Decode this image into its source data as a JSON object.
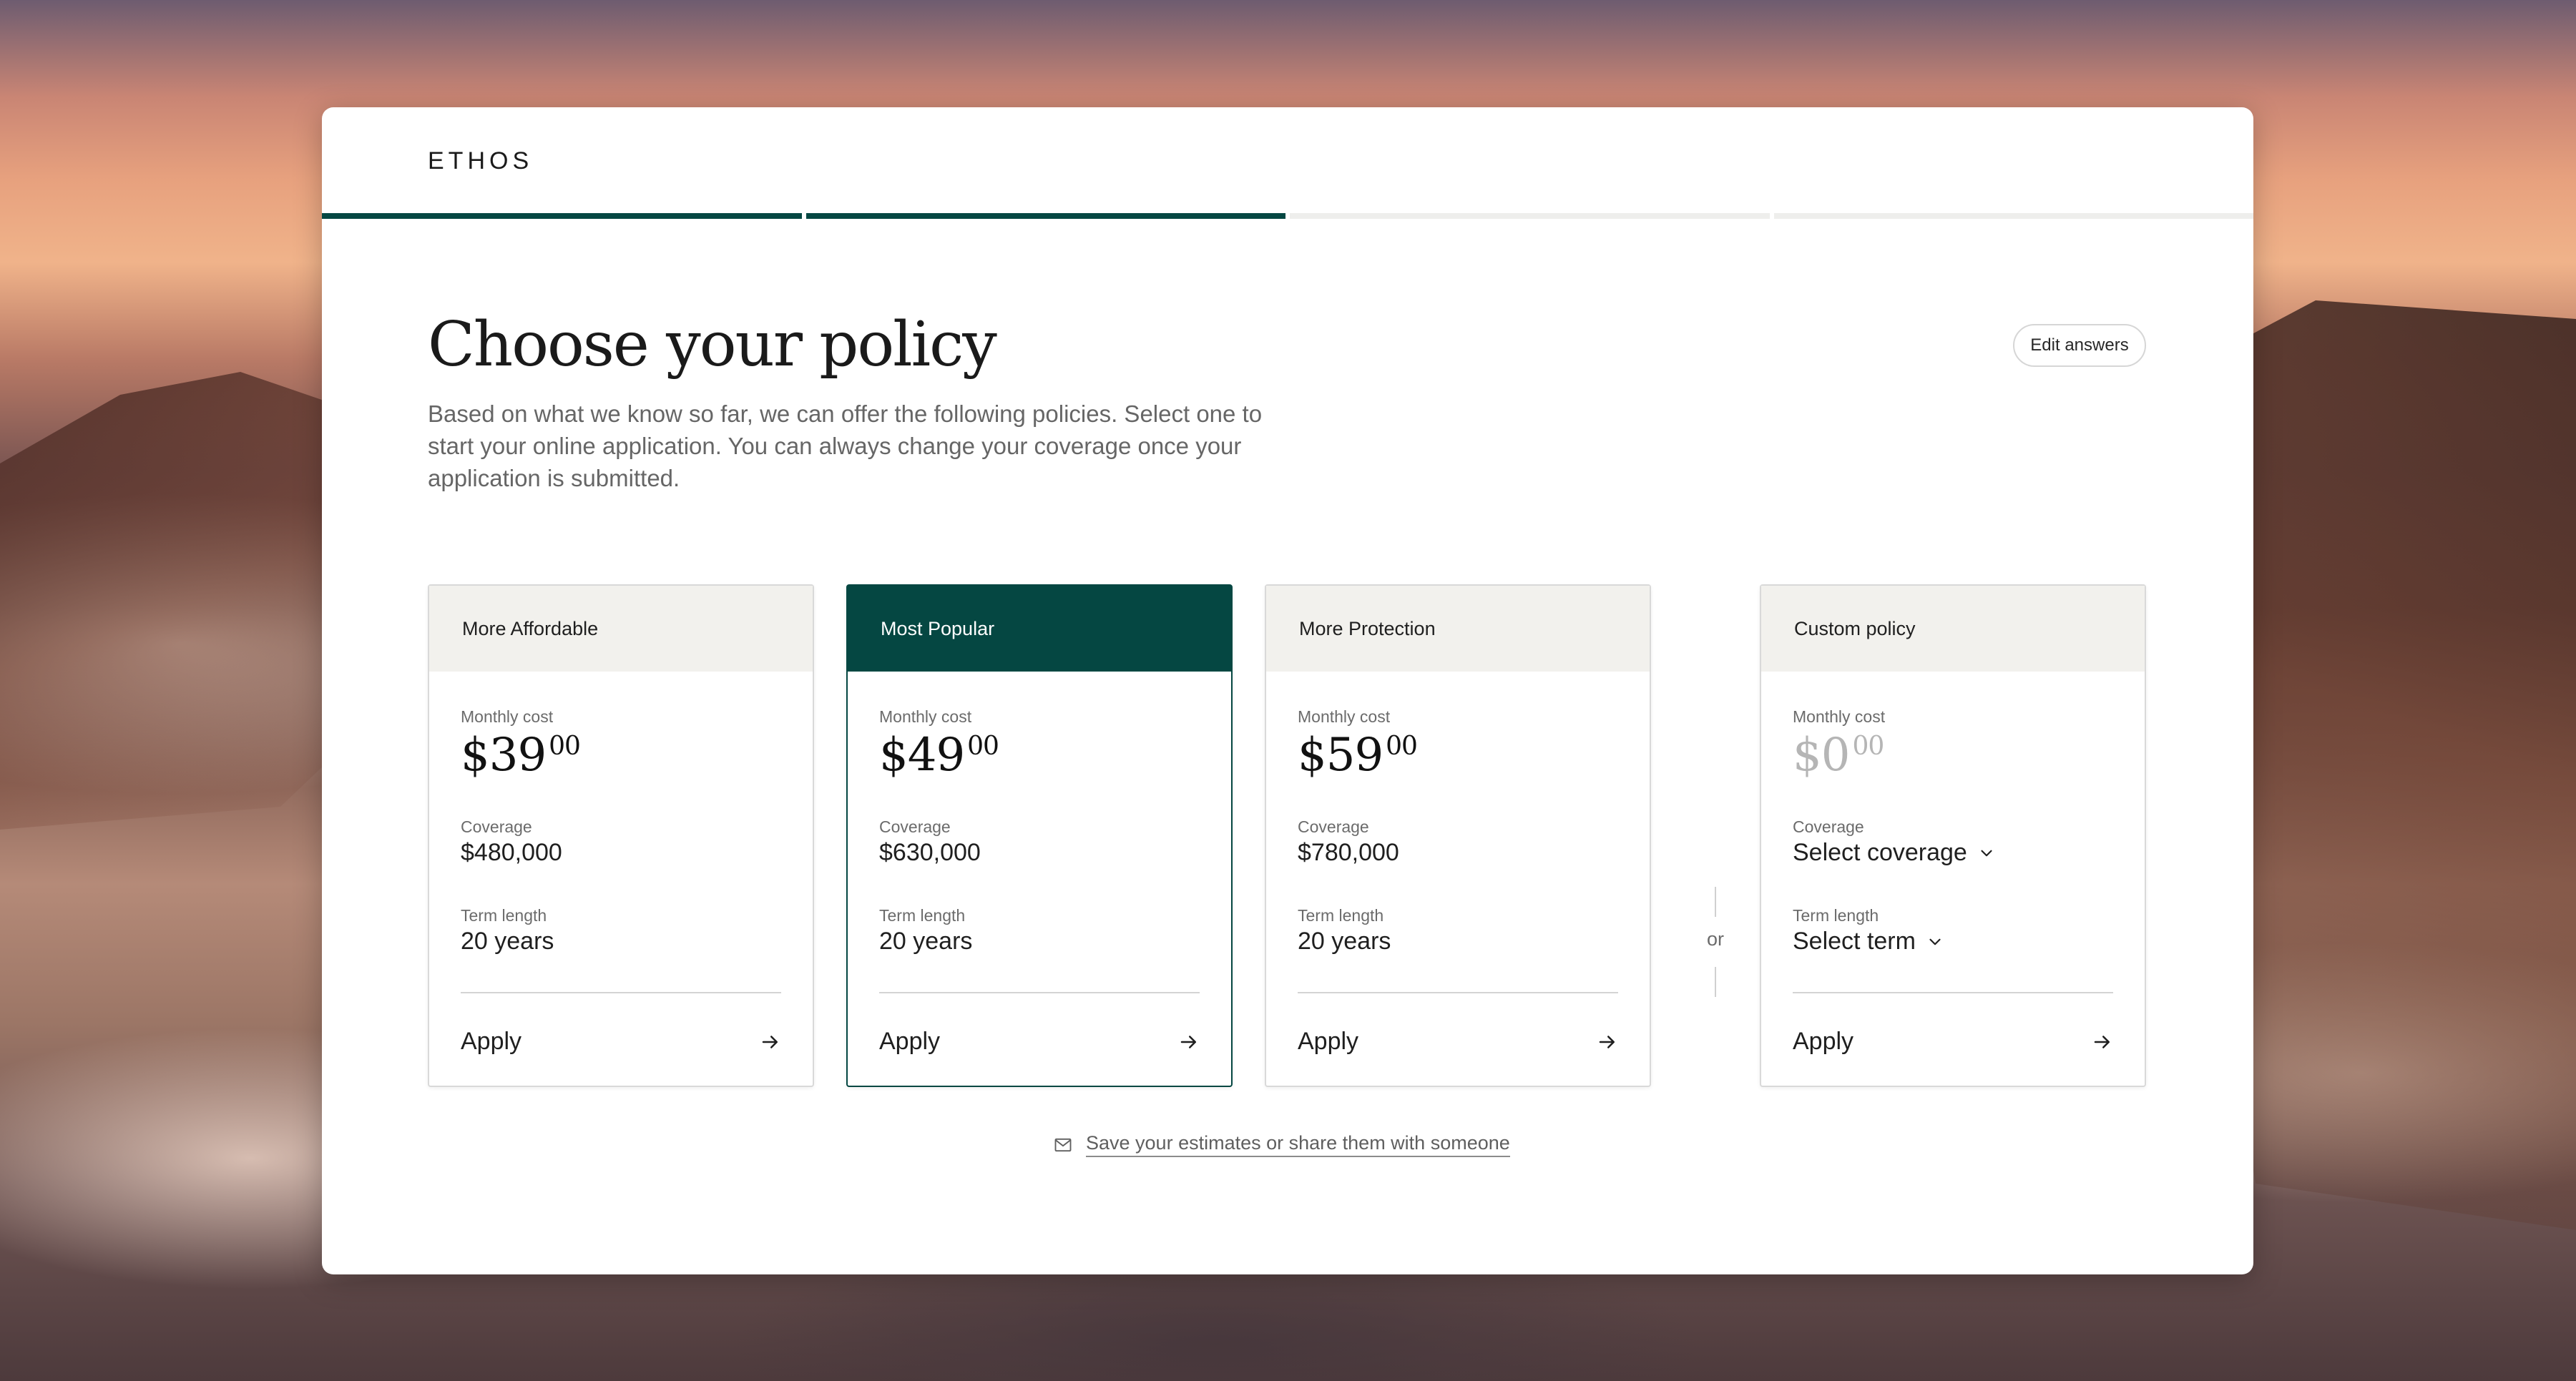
{
  "brand": {
    "logo": "ETHOS"
  },
  "progress": {
    "total_steps": 4,
    "completed_steps": 2
  },
  "header": {
    "title": "Choose your policy",
    "subtitle": "Based on what we know so far, we can offer the following policies. Select one to start your online application. You can always change your coverage once your application is submitted.",
    "edit_label": "Edit answers"
  },
  "plans": [
    {
      "name": "More Affordable",
      "cost_label": "Monthly cost",
      "price_dollars": "$39",
      "price_cents": "00",
      "coverage_label": "Coverage",
      "coverage": "$480,000",
      "term_label": "Term length",
      "term": "20 years",
      "apply_label": "Apply"
    },
    {
      "name": "Most Popular",
      "cost_label": "Monthly cost",
      "price_dollars": "$49",
      "price_cents": "00",
      "coverage_label": "Coverage",
      "coverage": "$630,000",
      "term_label": "Term length",
      "term": "20 years",
      "apply_label": "Apply"
    },
    {
      "name": "More Protection",
      "cost_label": "Monthly cost",
      "price_dollars": "$59",
      "price_cents": "00",
      "coverage_label": "Coverage",
      "coverage": "$780,000",
      "term_label": "Term length",
      "term": "20 years",
      "apply_label": "Apply"
    },
    {
      "name": "Custom policy",
      "cost_label": "Monthly cost",
      "price_dollars": "$0",
      "price_cents": "00",
      "coverage_label": "Coverage",
      "coverage": "Select coverage",
      "term_label": "Term length",
      "term": "Select term",
      "apply_label": "Apply"
    }
  ],
  "separator": {
    "or_label": "or"
  },
  "share": {
    "label": "Save your estimates or share them with someone",
    "icon": "mail-icon"
  },
  "colors": {
    "accent": "#054742",
    "card_head": "#f2f1ed",
    "muted_price": "#b5b5b5"
  }
}
